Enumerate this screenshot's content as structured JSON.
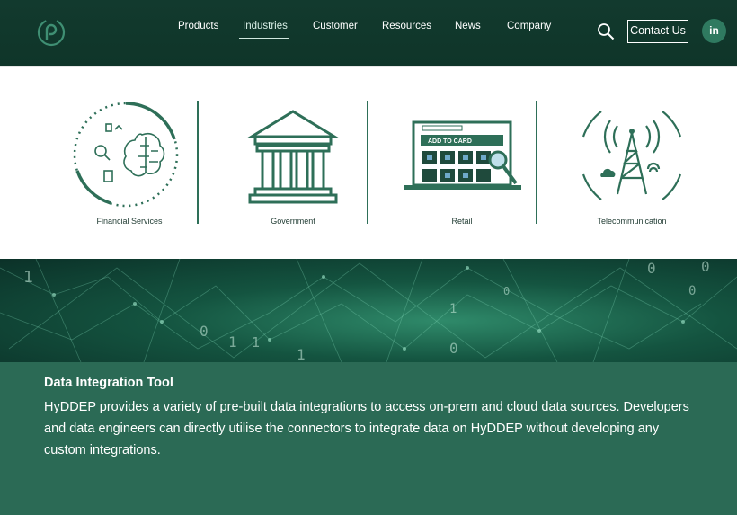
{
  "header": {
    "nav": [
      {
        "label": "Products"
      },
      {
        "label": "Industries",
        "active": true
      },
      {
        "label": "Customer"
      },
      {
        "label": "Resources"
      },
      {
        "label": "News"
      },
      {
        "label": "Company"
      }
    ],
    "contact_label": "Contact Us",
    "linkedin_label": "in"
  },
  "industries": [
    {
      "label": "Financial Services",
      "icon": "brain-finance-icon"
    },
    {
      "label": "Government",
      "icon": "government-building-icon"
    },
    {
      "label": "Retail",
      "icon": "retail-laptop-icon"
    },
    {
      "label": "Telecommunication",
      "icon": "telecom-tower-icon"
    }
  ],
  "retail_icon_text": "ADD TO CARD",
  "content": {
    "title": "Data Integration Tool",
    "body": "HyDDEP provides a variety of pre-built data integrations to access on-prem and cloud data sources. Developers and data engineers can directly utilise the connectors to integrate data on HyDDEP without developing any custom integrations."
  },
  "colors": {
    "header_bg": "#123a2e",
    "accent": "#2e6f58",
    "content_bg": "#2b6a55"
  }
}
